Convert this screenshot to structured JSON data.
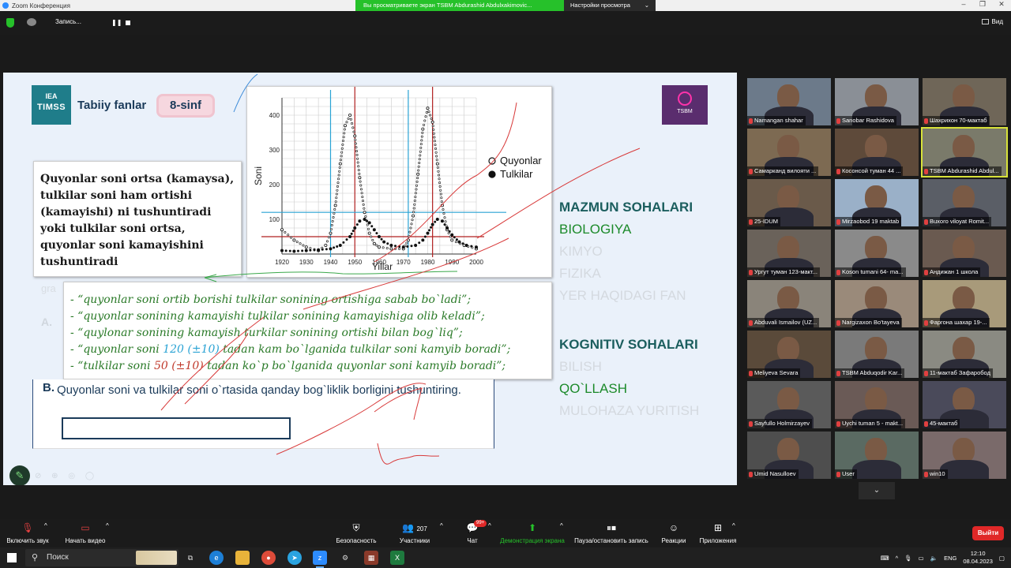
{
  "window": {
    "title": "Zoom Конференция",
    "share_banner": "Вы просматриваете экран TSBM Abdurashid Abdulxakimovic...",
    "view_options": "Настройки просмотра",
    "view_options_caret": "⌄"
  },
  "recording": {
    "label": "Запись...",
    "pause": "❚❚"
  },
  "top_right": {
    "view_label": "Вид"
  },
  "slide": {
    "logo_line1": "IEA",
    "logo_line2": "TIMSS",
    "subject": "Tabiiy fanlar",
    "grade": "8-sinf",
    "tsbm_logo": "TSBM",
    "rule_text": "Quyonlar soni ortsa (kamaysa), tulkilar soni ham ortishi (kamayishi) ni tushuntiradi yoki tulkilar soni ortsa, quyonlar soni kamayishini tushuntiradi",
    "faded_gra": "gra",
    "faded_a": "A.",
    "answers": {
      "a1": "- “quyonlar soni ortib borishi tulkilar sonining ortishiga sabab bo`ladi”;",
      "a2": "- “quyonlar sonining kamayishi tulkilar sonining kamayishiga olib keladi”;",
      "a3": "- “quylonar sonining kamayish turkilar sonining ortishi bilan bog`liq”;",
      "a4_pre": "- “quyonlar soni ",
      "a4_val": "120 (±10)",
      "a4_post": " tadan kam bo`lganida tulkilar soni kamyib boradi”;",
      "a5_pre": "- “tulkilar soni ",
      "a5_val": "50 (±10)",
      "a5_post": " tadan ko`p bo`lganida quyonlar soni kamyib boradi”;"
    },
    "question_b": {
      "label": "B.",
      "text": "Quyonlar soni va tulkilar soni o`rtasida qanday bog`liklik borligini tushuntiring."
    },
    "content_domains": {
      "heading": "MAZMUN SOHALARI",
      "items": [
        "BIOLOGIYA",
        "KIMYO",
        "FIZIKA",
        "YER HAQIDAGI FAN"
      ]
    },
    "cognitive_domains": {
      "heading": "KOGNITIV SOHALARI",
      "items": [
        "BILISH",
        "QO`LLASH",
        "MULOHAZA YURITISH"
      ]
    },
    "faded_tools": "⊘ ⊕ ◎ ◯"
  },
  "chart_data": {
    "type": "scatter",
    "title": "",
    "xlabel": "Yillar",
    "ylabel": "Soni",
    "xlim": [
      1920,
      2000
    ],
    "ylim": [
      0,
      450
    ],
    "x_ticks": [
      1920,
      1930,
      1940,
      1950,
      1960,
      1970,
      1980,
      1990,
      2000
    ],
    "y_ticks": [
      100,
      200,
      300,
      400
    ],
    "grid": true,
    "legend": {
      "placement": "right"
    },
    "series": [
      {
        "name": "Quyonlar",
        "marker": "open-circle",
        "x": [
          1920,
          1925,
          1930,
          1935,
          1938,
          1940,
          1942,
          1944,
          1946,
          1948,
          1950,
          1952,
          1954,
          1956,
          1958,
          1960,
          1965,
          1970,
          1972,
          1974,
          1976,
          1978,
          1980,
          1982,
          1984,
          1986,
          1988,
          1990,
          1995,
          2000
        ],
        "y": [
          70,
          40,
          20,
          10,
          25,
          60,
          140,
          260,
          370,
          400,
          340,
          220,
          120,
          60,
          30,
          20,
          15,
          15,
          40,
          110,
          230,
          360,
          420,
          380,
          260,
          140,
          70,
          40,
          25,
          15
        ]
      },
      {
        "name": "Tulkilar",
        "marker": "filled-circle",
        "x": [
          1920,
          1925,
          1930,
          1935,
          1940,
          1944,
          1948,
          1950,
          1952,
          1954,
          1956,
          1958,
          1960,
          1962,
          1965,
          1970,
          1975,
          1978,
          1980,
          1982,
          1984,
          1986,
          1988,
          1990,
          1993,
          1996,
          2000
        ],
        "y": [
          10,
          8,
          10,
          12,
          15,
          25,
          50,
          75,
          95,
          100,
          90,
          70,
          50,
          35,
          25,
          20,
          25,
          40,
          60,
          85,
          100,
          95,
          75,
          55,
          35,
          25,
          20
        ]
      }
    ]
  },
  "gallery": {
    "participants": [
      {
        "name": "Namangan shahar",
        "bg": "#6c7a8a"
      },
      {
        "name": "Sanobar Rashidova",
        "bg": "#8a8f96"
      },
      {
        "name": "Шахрихон 70-мактаб",
        "bg": "#6f6658"
      },
      {
        "name": "Самарканд вилояти ...",
        "bg": "#7d6a52"
      },
      {
        "name": "Косонсой туман 44 ...",
        "bg": "#5e4a3a"
      },
      {
        "name": "TSBM Abdurashid Abdul...",
        "bg": "#7a7a6a"
      },
      {
        "name": "25-IDUM",
        "bg": "#6a5a4a"
      },
      {
        "name": "Mirzaobod 19 maktab",
        "bg": "#9ab0c8"
      },
      {
        "name": "Buxoro viloyat Romit...",
        "bg": "#5a5e66"
      },
      {
        "name": "Ургут туман 123-макт...",
        "bg": "#6a625a"
      },
      {
        "name": "Koson tumani 64- ma...",
        "bg": "#8a8a8a"
      },
      {
        "name": "Андижан 1 школа",
        "bg": "#6a5a50"
      },
      {
        "name": "Abduvali Ismailov (UZ...",
        "bg": "#8a847a"
      },
      {
        "name": "Nargizaxon Bo'tayeva",
        "bg": "#9a8a7a"
      },
      {
        "name": "Фаргона шахар 19-...",
        "bg": "#a89a7a"
      },
      {
        "name": "Meliyeva Sevara",
        "bg": "#5a4a3a"
      },
      {
        "name": "TSBM Abduqodir Kar...",
        "bg": "#7a7a7a"
      },
      {
        "name": "11-мактаб Зафаробод",
        "bg": "#8a8a82"
      },
      {
        "name": "Sayfullo Holmirzayev",
        "bg": "#5a5a5a"
      },
      {
        "name": "Uychi tuman 5 - makt...",
        "bg": "#6a5a56"
      },
      {
        "name": "45-мактаб",
        "bg": "#4a4a5a"
      },
      {
        "name": "Umid Nasulloev",
        "bg": "#4e4e4e"
      },
      {
        "name": "User",
        "bg": "#5a6a62"
      },
      {
        "name": "win10",
        "bg": "#7a6a6a"
      }
    ],
    "more_label": "⌄"
  },
  "toolbar": {
    "mute_label": "Включить звук",
    "video_label": "Начать видео",
    "security_label": "Безопасность",
    "participants_label": "Участники",
    "participants_count": "207",
    "chat_label": "Чат",
    "chat_badge": "99+",
    "share_label": "Демонстрация экрана",
    "pause_rec_label": "Пауза/остановить запись",
    "reactions_label": "Реакции",
    "apps_label": "Приложения",
    "exit_label": "Выйти"
  },
  "taskbar": {
    "search_placeholder": "Поиск",
    "lang": "ENG",
    "time": "12:10",
    "date": "08.04.2023"
  },
  "colors": {
    "timss_teal": "#1f7d8a",
    "answer_green": "#2a7a28",
    "highlight_blue": "#2aa3d4",
    "highlight_red": "#c0392b",
    "share_green": "#26c12a",
    "exit_red": "#e02828"
  }
}
